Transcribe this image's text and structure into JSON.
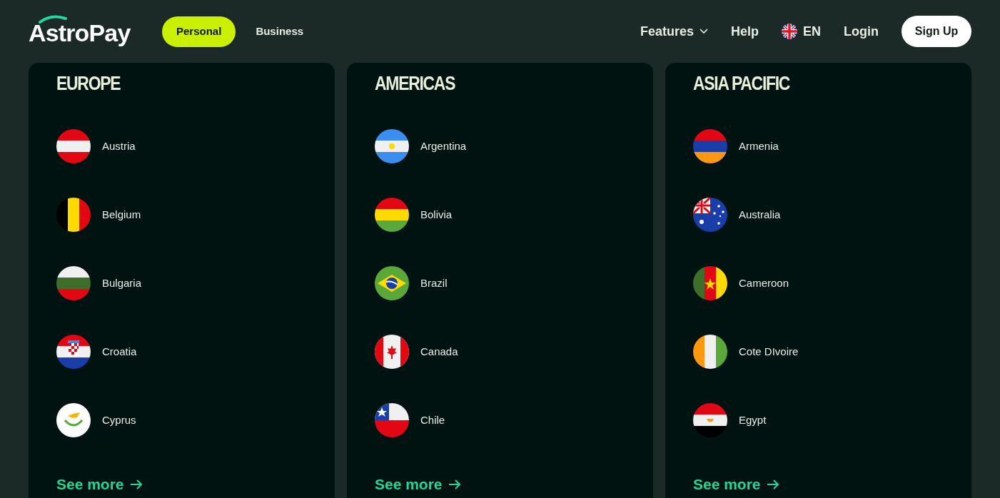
{
  "header": {
    "logo": "AstroPay",
    "tabs": [
      {
        "label": "Personal",
        "selected": true
      },
      {
        "label": "Business",
        "selected": false
      }
    ],
    "nav": [
      {
        "kind": "dropdown",
        "label": "Features"
      },
      {
        "kind": "link",
        "label": "Help"
      },
      {
        "kind": "language",
        "label": "EN"
      },
      {
        "kind": "link",
        "label": "Login"
      }
    ],
    "signup": "Sign Up"
  },
  "regions": [
    {
      "title": "EUROPE",
      "countries": [
        "Austria",
        "Belgium",
        "Bulgaria",
        "Croatia",
        "Cyprus"
      ],
      "link": "See more"
    },
    {
      "title": "AMERICAS",
      "countries": [
        "Argentina",
        "Bolivia",
        "Brazil",
        "Canada",
        "Chile"
      ],
      "link": "See more"
    },
    {
      "title": "ASIA PACIFIC",
      "countries": [
        "Armenia",
        "Australia",
        "Cameroon",
        "Cote DIvoire",
        "Egypt"
      ],
      "link": "See more"
    }
  ]
}
